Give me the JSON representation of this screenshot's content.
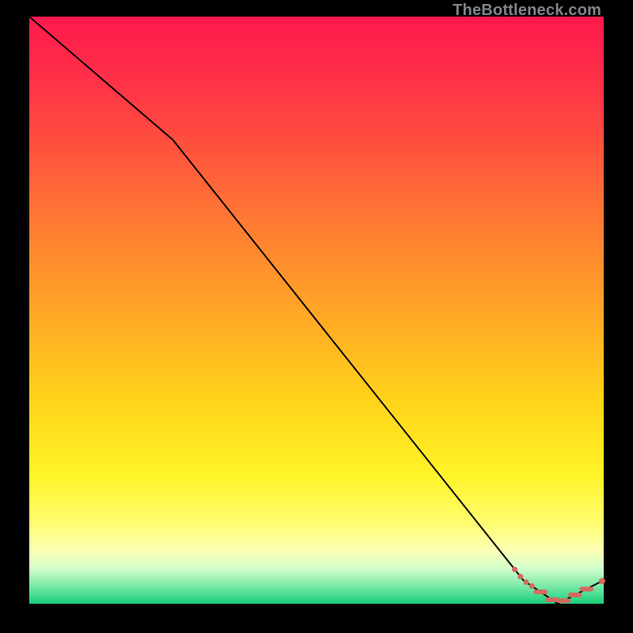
{
  "watermark": "TheBottleneck.com",
  "chart_data": {
    "type": "line",
    "title": "",
    "xlabel": "",
    "ylabel": "",
    "xlim": [
      0,
      100
    ],
    "ylim": [
      0,
      100
    ],
    "grid": false,
    "series": [
      {
        "name": "curve",
        "x": [
          0,
          25,
          86,
          92,
          100
        ],
        "values": [
          100,
          79,
          4,
          0,
          4
        ]
      }
    ],
    "markers_region": {
      "start_x": 84,
      "end_x": 100,
      "note": "dense markers along curve bottom"
    }
  },
  "colors": {
    "curve": "#000000",
    "marker": "#d46a5f",
    "gradient_top": "#ff1a4d",
    "gradient_bottom": "#18ce7a"
  }
}
